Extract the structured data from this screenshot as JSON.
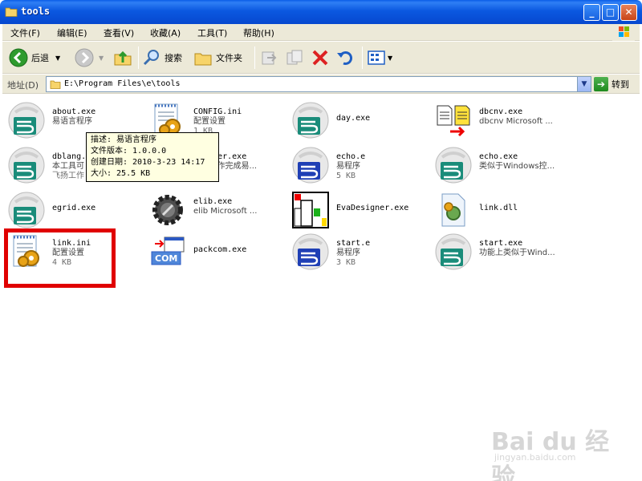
{
  "window": {
    "title": "tools"
  },
  "menu": [
    "文件(F)",
    "编辑(E)",
    "查看(V)",
    "收藏(A)",
    "工具(T)",
    "帮助(H)"
  ],
  "toolbar": {
    "back_label": "后退",
    "search_label": "搜索",
    "folders_label": "文件夹"
  },
  "address": {
    "label": "地址(D)",
    "path": "E:\\Program Files\\e\\tools",
    "go_label": "转到"
  },
  "files": [
    {
      "name": "about.exe",
      "sub": "易语言程序",
      "size": "",
      "icon": "e-program-icon"
    },
    {
      "name": "CONFIG.ini",
      "sub": "配置设置",
      "size": "1 KB",
      "icon": "config-file-icon"
    },
    {
      "name": "day.exe",
      "sub": "",
      "size": "",
      "icon": "e-program-icon"
    },
    {
      "name": "dbcnv.exe",
      "sub": "dbcnv Microsoft ...",
      "size": "",
      "icon": "dbcnv-icon"
    },
    {
      "name": "dblang.",
      "sub": "本工具可",
      "size": "飞扬工作",
      "icon": "e-program-icon"
    },
    {
      "name": "...ager.exe",
      "sub": "...使用作完成易...",
      "size": "",
      "icon": "config-file-icon"
    },
    {
      "name": "echo.e",
      "sub": "易程序",
      "size": "5 KB",
      "icon": "e-source-icon"
    },
    {
      "name": "echo.exe",
      "sub": "类似于Windows控...",
      "size": "",
      "icon": "e-program-icon"
    },
    {
      "name": "egrid.exe",
      "sub": "",
      "size": "",
      "icon": "e-program-icon"
    },
    {
      "name": "elib.exe",
      "sub": "elib Microsoft ...",
      "size": "",
      "icon": "gear-icon"
    },
    {
      "name": "EvaDesigner.exe",
      "sub": "",
      "size": "",
      "icon": "eva-designer-icon"
    },
    {
      "name": "link.dll",
      "sub": "",
      "size": "",
      "icon": "dll-file-icon"
    },
    {
      "name": "link.ini",
      "sub": "配置设置",
      "size": "4 KB",
      "icon": "config-file-icon"
    },
    {
      "name": "packcom.exe",
      "sub": "",
      "size": "",
      "icon": "com-package-icon"
    },
    {
      "name": "start.e",
      "sub": "易程序",
      "size": "3 KB",
      "icon": "e-source-icon"
    },
    {
      "name": "start.exe",
      "sub": "功能上类似于Wind...",
      "size": "",
      "icon": "e-program-icon"
    }
  ],
  "tooltip": {
    "lines": [
      "描述: 易语言程序",
      "文件版本: 1.0.0.0",
      "创建日期: 2010-3-23 14:17",
      "大小: 25.5 KB"
    ]
  },
  "watermark": {
    "main": "Bai du 经验",
    "sub": "jingyan.baidu.com"
  },
  "colors": {
    "titlebar": "#0648cf",
    "highlight": "#e00000",
    "tooltip_bg": "#ffffe1",
    "chrome": "#ece9d8"
  }
}
